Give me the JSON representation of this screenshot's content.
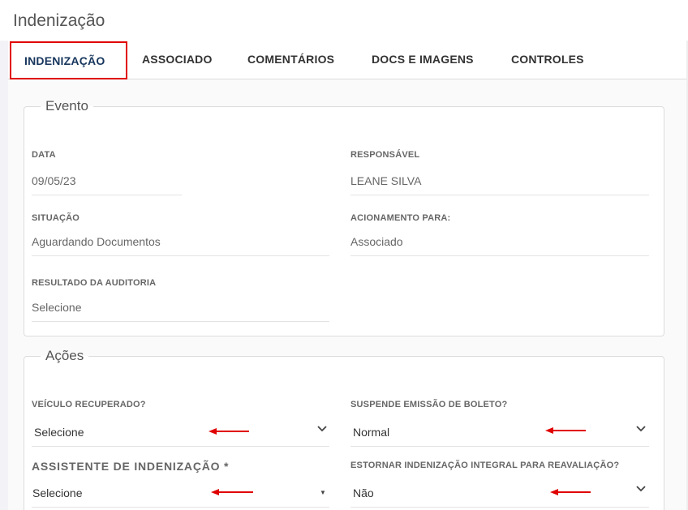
{
  "page": {
    "title": "Indenização"
  },
  "tabs": [
    {
      "label": "INDENIZAÇÃO",
      "active": true
    },
    {
      "label": "ASSOCIADO"
    },
    {
      "label": "COMENTÁRIOS"
    },
    {
      "label": "DOCS E IMAGENS"
    },
    {
      "label": "CONTROLES"
    }
  ],
  "evento": {
    "legend": "Evento",
    "data": {
      "label": "DATA",
      "value": "09/05/23"
    },
    "responsavel": {
      "label": "RESPONSÁVEL",
      "value": "LEANE SILVA"
    },
    "situacao": {
      "label": "SITUAÇÃO",
      "value": "Aguardando Documentos"
    },
    "acionamento": {
      "label": "ACIONAMENTO PARA:",
      "value": "Associado"
    },
    "resultado": {
      "label": "RESULTADO DA AUDITORIA",
      "value": "Selecione"
    }
  },
  "acoes": {
    "legend": "Ações",
    "veiculo": {
      "label": "VEÍCULO RECUPERADO?",
      "value": "Selecione"
    },
    "suspende": {
      "label": "SUSPENDE EMISSÃO DE BOLETO?",
      "value": "Normal"
    },
    "assistente": {
      "label": "ASSISTENTE DE INDENIZAÇÃO *",
      "value": "Selecione"
    },
    "estornar": {
      "label": "ESTORNAR INDENIZAÇÃO INTEGRAL PARA REAVALIAÇÃO?",
      "value": "Não"
    }
  },
  "colors": {
    "active_tab_border": "#e00000",
    "active_tab_text": "#17365d",
    "annotation_arrow": "#e00000"
  },
  "icons": {
    "select_chevron": "chevron-down-icon",
    "annotation": "red-arrow-left-icon"
  }
}
